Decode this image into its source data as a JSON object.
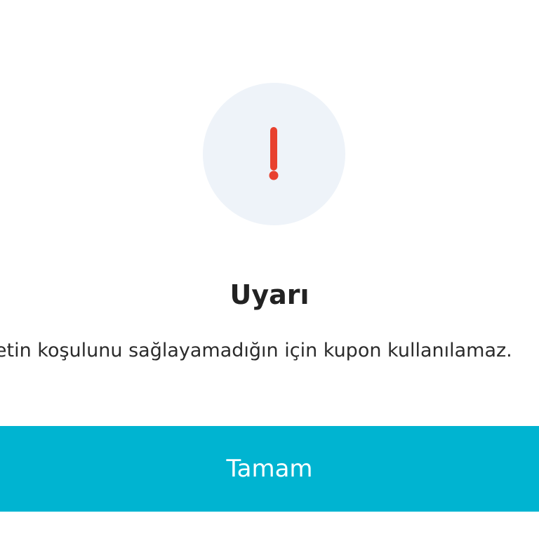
{
  "dialog": {
    "icon": "exclamation-icon",
    "title": "Uyarı",
    "message": "Sepetin koşulunu sağlayamadığın için kupon kullanılamaz.",
    "ok_label": "Tamam"
  },
  "colors": {
    "accent": "#00b4d1",
    "icon_bg": "#eef3f9",
    "icon_fg": "#e8412f",
    "title_text": "#222222"
  }
}
